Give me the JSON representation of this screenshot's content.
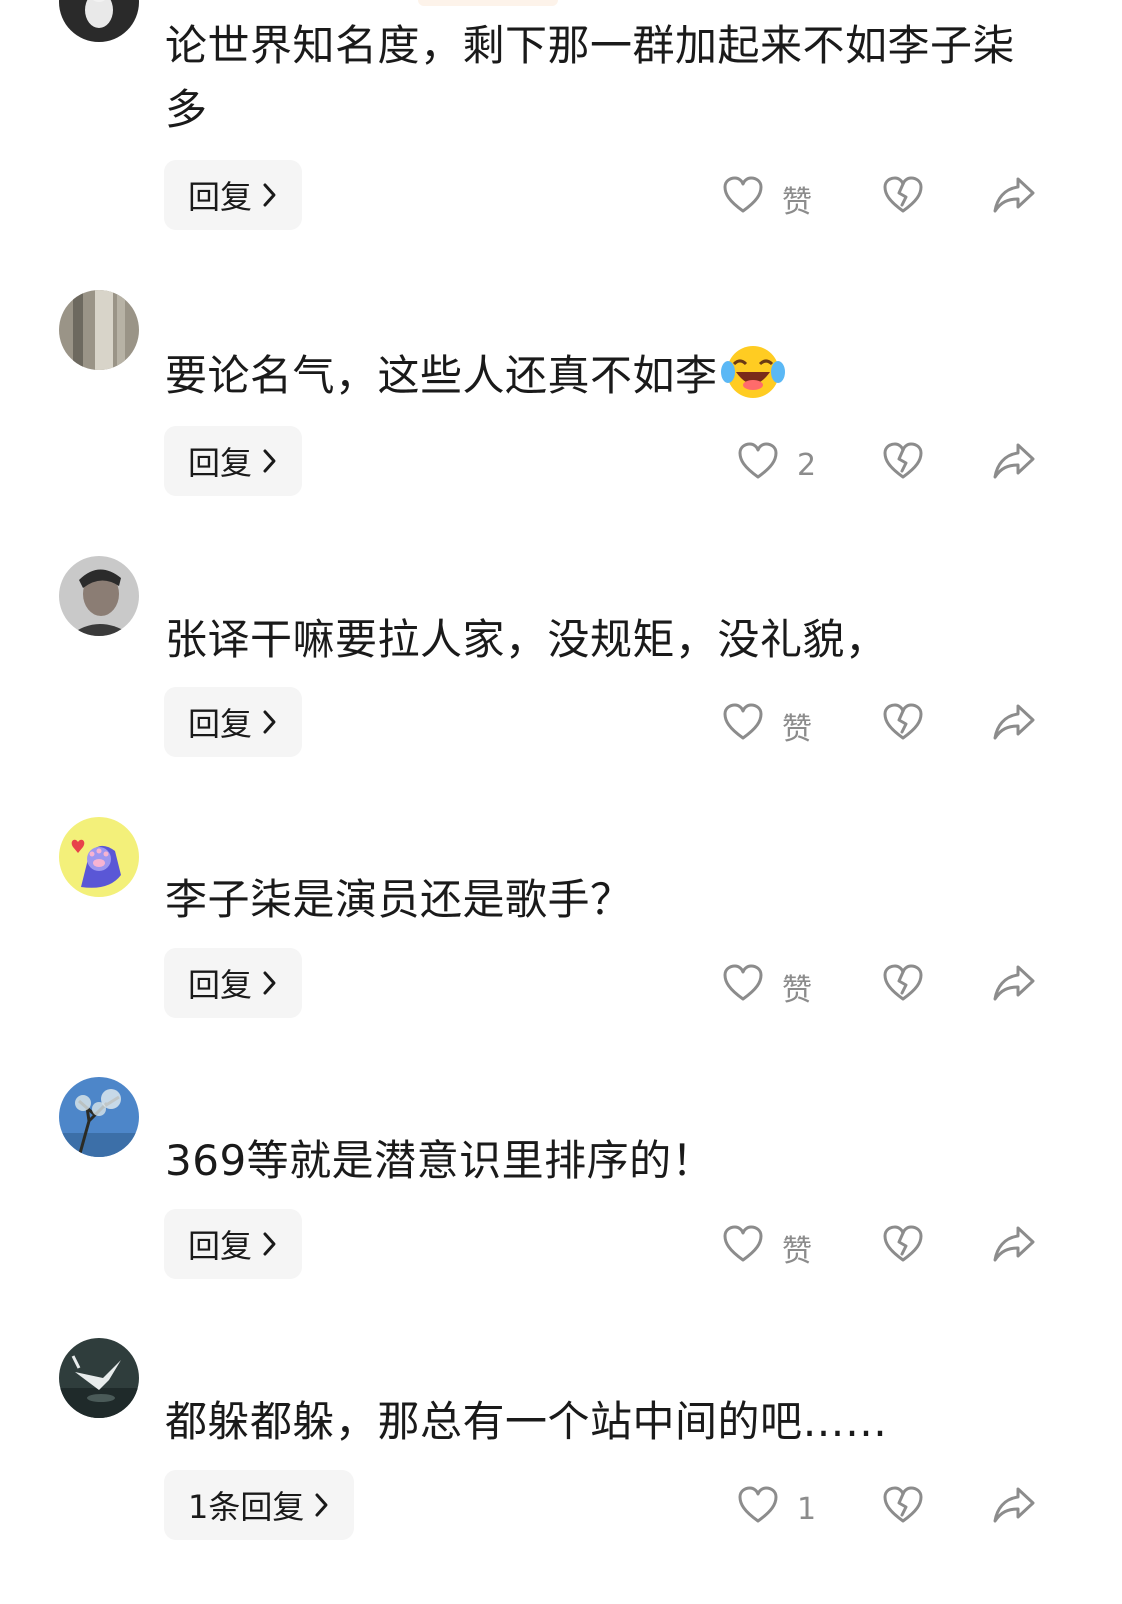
{
  "comments": [
    {
      "text": "论世界知名度，剩下那一群加起来不如李子柒多",
      "reply_label": "回复",
      "like_label": "赞"
    },
    {
      "text": "要论名气，这些人还真不如李",
      "reply_label": "回复",
      "like_label": "2"
    },
    {
      "text": "张译干嘛要拉人家，没规矩，没礼貌，",
      "reply_label": "回复",
      "like_label": "赞"
    },
    {
      "text": "李子柒是演员还是歌手？",
      "reply_label": "回复",
      "like_label": "赞"
    },
    {
      "text": "369等就是潜意识里排序的！",
      "reply_label": "回复",
      "like_label": "赞"
    },
    {
      "text": "都躲都躲，那总有一个站中间的吧……",
      "reply_label": "1条回复",
      "like_label": "1"
    }
  ],
  "icons": {
    "like": "heart-icon",
    "dislike": "broken-heart-icon",
    "share": "share-arrow-icon",
    "reply_more": "chevron-right-icon",
    "emoji": "laughing-tears-emoji"
  },
  "colors": {
    "text": "#1a1a1a",
    "muted": "#8c8c8c",
    "reply_bg": "#f5f5f5"
  }
}
